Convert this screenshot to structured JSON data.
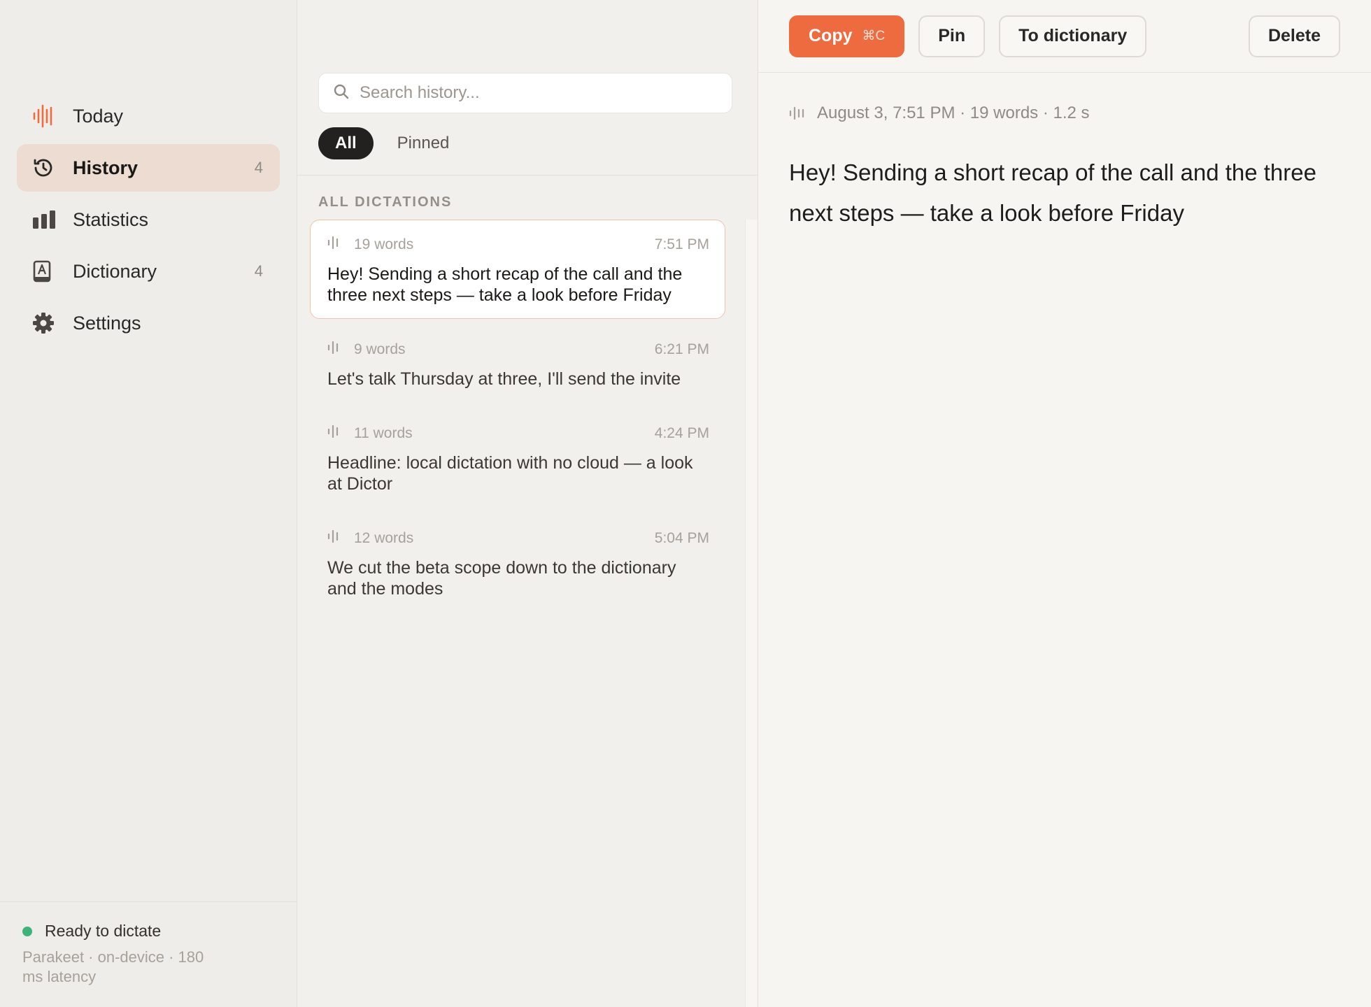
{
  "sidebar": {
    "items": [
      {
        "label": "Today",
        "count": "",
        "icon": "waveform-icon"
      },
      {
        "label": "History",
        "count": "4",
        "icon": "history-icon"
      },
      {
        "label": "Statistics",
        "count": "",
        "icon": "bar-chart-icon"
      },
      {
        "label": "Dictionary",
        "count": "4",
        "icon": "dictionary-icon"
      },
      {
        "label": "Settings",
        "count": "",
        "icon": "gear-icon"
      }
    ],
    "status": {
      "text": "Ready to dictate",
      "sub": "Parakeet · on-device · 180 ms latency",
      "color": "#3db37a"
    }
  },
  "list": {
    "search_placeholder": "Search history...",
    "filters": [
      "All",
      "Pinned"
    ],
    "section_title": "ALL DICTATIONS",
    "items": [
      {
        "words": "19 words",
        "time": "7:51 PM",
        "text": "Hey! Sending a short recap of the call and the three next steps — take a look before Friday"
      },
      {
        "words": "9 words",
        "time": "6:21 PM",
        "text": "Let's talk Thursday at three, I'll send the invite"
      },
      {
        "words": "11 words",
        "time": "4:24 PM",
        "text": "Headline: local dictation with no cloud — a look at Dictor"
      },
      {
        "words": "12 words",
        "time": "5:04 PM",
        "text": "We cut the beta scope down to the dictionary and the modes"
      }
    ]
  },
  "detail": {
    "toolbar": {
      "copy_label": "Copy",
      "copy_shortcut": "⌘C",
      "pin_label": "Pin",
      "dictionary_label": "To dictionary",
      "delete_label": "Delete"
    },
    "meta": "August 3, 7:51 PM · 19 words · 1.2 s",
    "text": "Hey! Sending a short recap of the call and the three next steps — take a look before Friday"
  },
  "colors": {
    "accent": "#ee6a3f",
    "active_nav": "#ecdcd1"
  }
}
